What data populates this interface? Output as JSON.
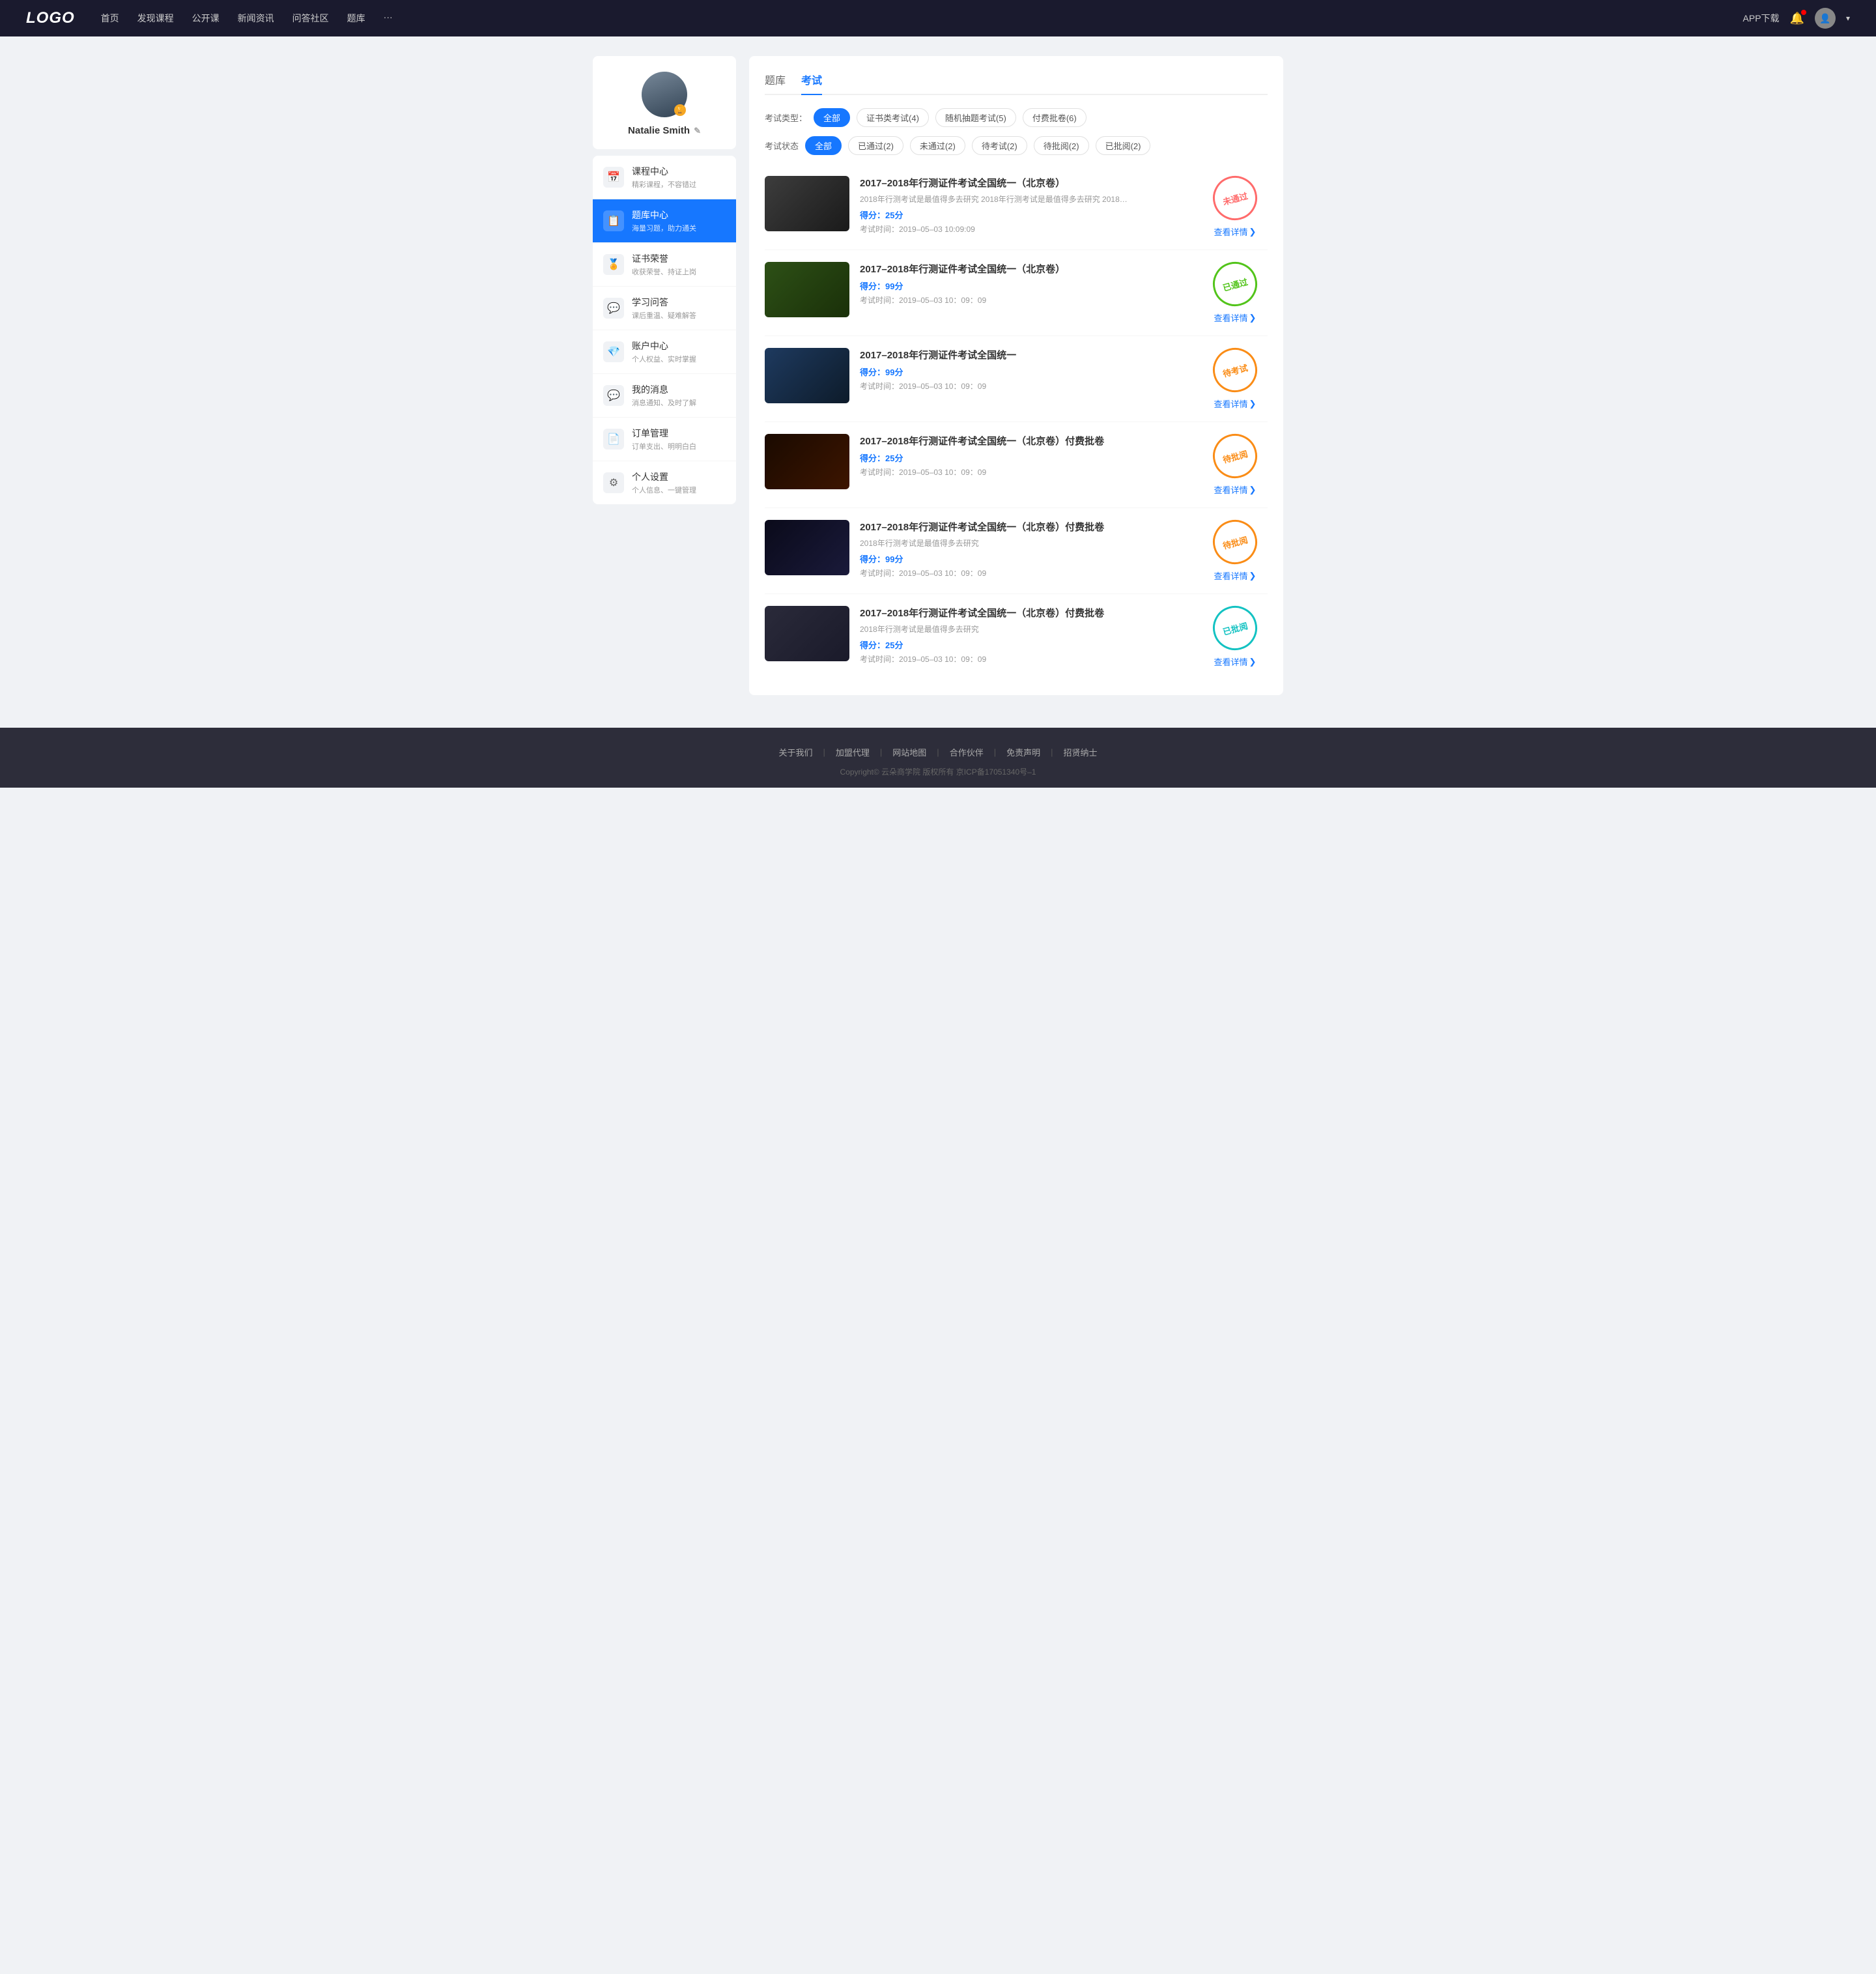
{
  "header": {
    "logo": "LOGO",
    "nav": [
      {
        "label": "首页"
      },
      {
        "label": "发现课程"
      },
      {
        "label": "公开课"
      },
      {
        "label": "新闻资讯"
      },
      {
        "label": "问答社区"
      },
      {
        "label": "题库"
      },
      {
        "label": "···"
      }
    ],
    "app_btn": "APP下载",
    "more_icon": "···"
  },
  "sidebar": {
    "profile": {
      "name": "Natalie Smith",
      "edit_icon": "✎"
    },
    "menu": [
      {
        "id": "course",
        "icon": "📅",
        "title": "课程中心",
        "desc": "精彩课程，不容错过"
      },
      {
        "id": "exam",
        "icon": "📋",
        "title": "题库中心",
        "desc": "海量习题，助力通关",
        "active": true
      },
      {
        "id": "cert",
        "icon": "🏅",
        "title": "证书荣誉",
        "desc": "收获荣誉、持证上岗"
      },
      {
        "id": "qa",
        "icon": "💬",
        "title": "学习问答",
        "desc": "课后重温、疑难解答"
      },
      {
        "id": "account",
        "icon": "💎",
        "title": "账户中心",
        "desc": "个人权益、实时掌握"
      },
      {
        "id": "msg",
        "icon": "💬",
        "title": "我的消息",
        "desc": "消息通知、及时了解"
      },
      {
        "id": "order",
        "icon": "📄",
        "title": "订单管理",
        "desc": "订单支出、明明白白"
      },
      {
        "id": "settings",
        "icon": "⚙",
        "title": "个人设置",
        "desc": "个人信息、一键管理"
      }
    ]
  },
  "content": {
    "tabs": [
      {
        "label": "题库"
      },
      {
        "label": "考试",
        "active": true
      }
    ],
    "filter_type": {
      "label": "考试类型：",
      "options": [
        {
          "label": "全部",
          "active": true
        },
        {
          "label": "证书类考试(4)"
        },
        {
          "label": "随机抽题考试(5)"
        },
        {
          "label": "付费批卷(6)"
        }
      ]
    },
    "filter_status": {
      "label": "考试状态",
      "options": [
        {
          "label": "全部",
          "active": true
        },
        {
          "label": "已通过(2)"
        },
        {
          "label": "未通过(2)"
        },
        {
          "label": "待考试(2)"
        },
        {
          "label": "待批阅(2)"
        },
        {
          "label": "已批阅(2)"
        }
      ]
    },
    "exams": [
      {
        "id": 1,
        "title": "2017–2018年行测证件考试全国统一（北京卷）",
        "desc": "2018年行测考试是最值得多去研究 2018年行测考试是最值得多去研究 2018年行…",
        "score_label": "得分：",
        "score": "25",
        "score_unit": "分",
        "time_label": "考试时间：",
        "time": "2019–05–03  10:09:09",
        "status": "未通过",
        "stamp_class": "stamp-red",
        "detail_btn": "查看详情",
        "thumb_class": "thumb-img-1"
      },
      {
        "id": 2,
        "title": "2017–2018年行测证件考试全国统一（北京卷）",
        "desc": "",
        "score_label": "得分：",
        "score": "99",
        "score_unit": "分",
        "time_label": "考试时间：",
        "time": "2019–05–03  10：09：09",
        "status": "已通过",
        "stamp_class": "stamp-green",
        "detail_btn": "查看详情",
        "thumb_class": "thumb-img-2"
      },
      {
        "id": 3,
        "title": "2017–2018年行测证件考试全国统一",
        "desc": "",
        "score_label": "得分：",
        "score": "99",
        "score_unit": "分",
        "time_label": "考试时间：",
        "time": "2019–05–03  10：09：09",
        "status": "待考试",
        "stamp_class": "stamp-orange",
        "detail_btn": "查看详情",
        "thumb_class": "thumb-img-3"
      },
      {
        "id": 4,
        "title": "2017–2018年行测证件考试全国统一（北京卷）付费批卷",
        "desc": "",
        "score_label": "得分：",
        "score": "25",
        "score_unit": "分",
        "time_label": "考试时间：",
        "time": "2019–05–03  10：09：09",
        "status": "待批阅",
        "stamp_class": "stamp-orange",
        "detail_btn": "查看详情",
        "thumb_class": "thumb-img-4"
      },
      {
        "id": 5,
        "title": "2017–2018年行测证件考试全国统一（北京卷）付费批卷",
        "desc": "2018年行测考试是最值得多去研究",
        "score_label": "得分：",
        "score": "99",
        "score_unit": "分",
        "time_label": "考试时间：",
        "time": "2019–05–03  10：09：09",
        "status": "待批阅",
        "stamp_class": "stamp-orange",
        "detail_btn": "查看详情",
        "thumb_class": "thumb-img-5"
      },
      {
        "id": 6,
        "title": "2017–2018年行测证件考试全国统一（北京卷）付费批卷",
        "desc": "2018年行测考试是最值得多去研究",
        "score_label": "得分：",
        "score": "25",
        "score_unit": "分",
        "time_label": "考试时间：",
        "time": "2019–05–03  10：09：09",
        "status": "已批阅",
        "stamp_class": "stamp-teal",
        "detail_btn": "查看详情",
        "thumb_class": "thumb-img-6"
      }
    ]
  },
  "footer": {
    "links": [
      "关于我们",
      "加盟代理",
      "网站地图",
      "合作伙伴",
      "免责声明",
      "招贤纳士"
    ],
    "copyright": "Copyright© 云朵商学院  版权所有    京ICP备17051340号–1"
  }
}
